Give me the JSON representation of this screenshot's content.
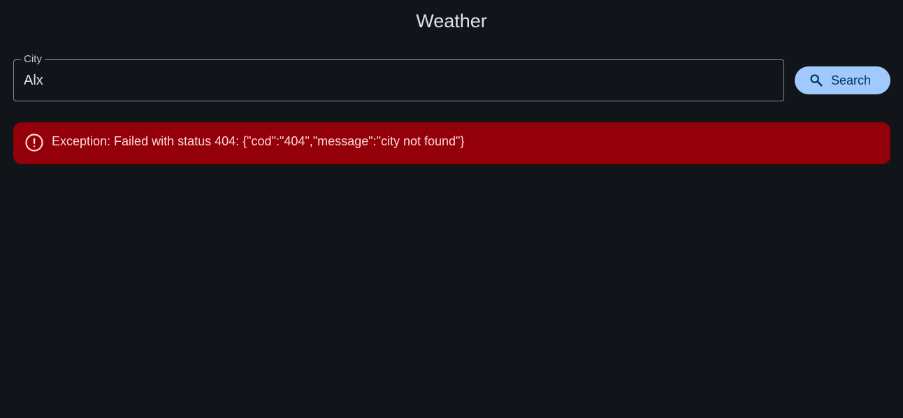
{
  "app": {
    "title": "Weather"
  },
  "search": {
    "field_label": "City",
    "value": "Alx",
    "button_label": "Search",
    "button_icon": "search-icon"
  },
  "error": {
    "icon": "error-icon",
    "message": "Exception: Failed with status 404: {\"cod\":\"404\",\"message\":\"city not found\"}"
  },
  "colors": {
    "background": "#111418",
    "button": "#a0cafd",
    "error_background": "#93000a",
    "error_text": "#ffdad6"
  }
}
